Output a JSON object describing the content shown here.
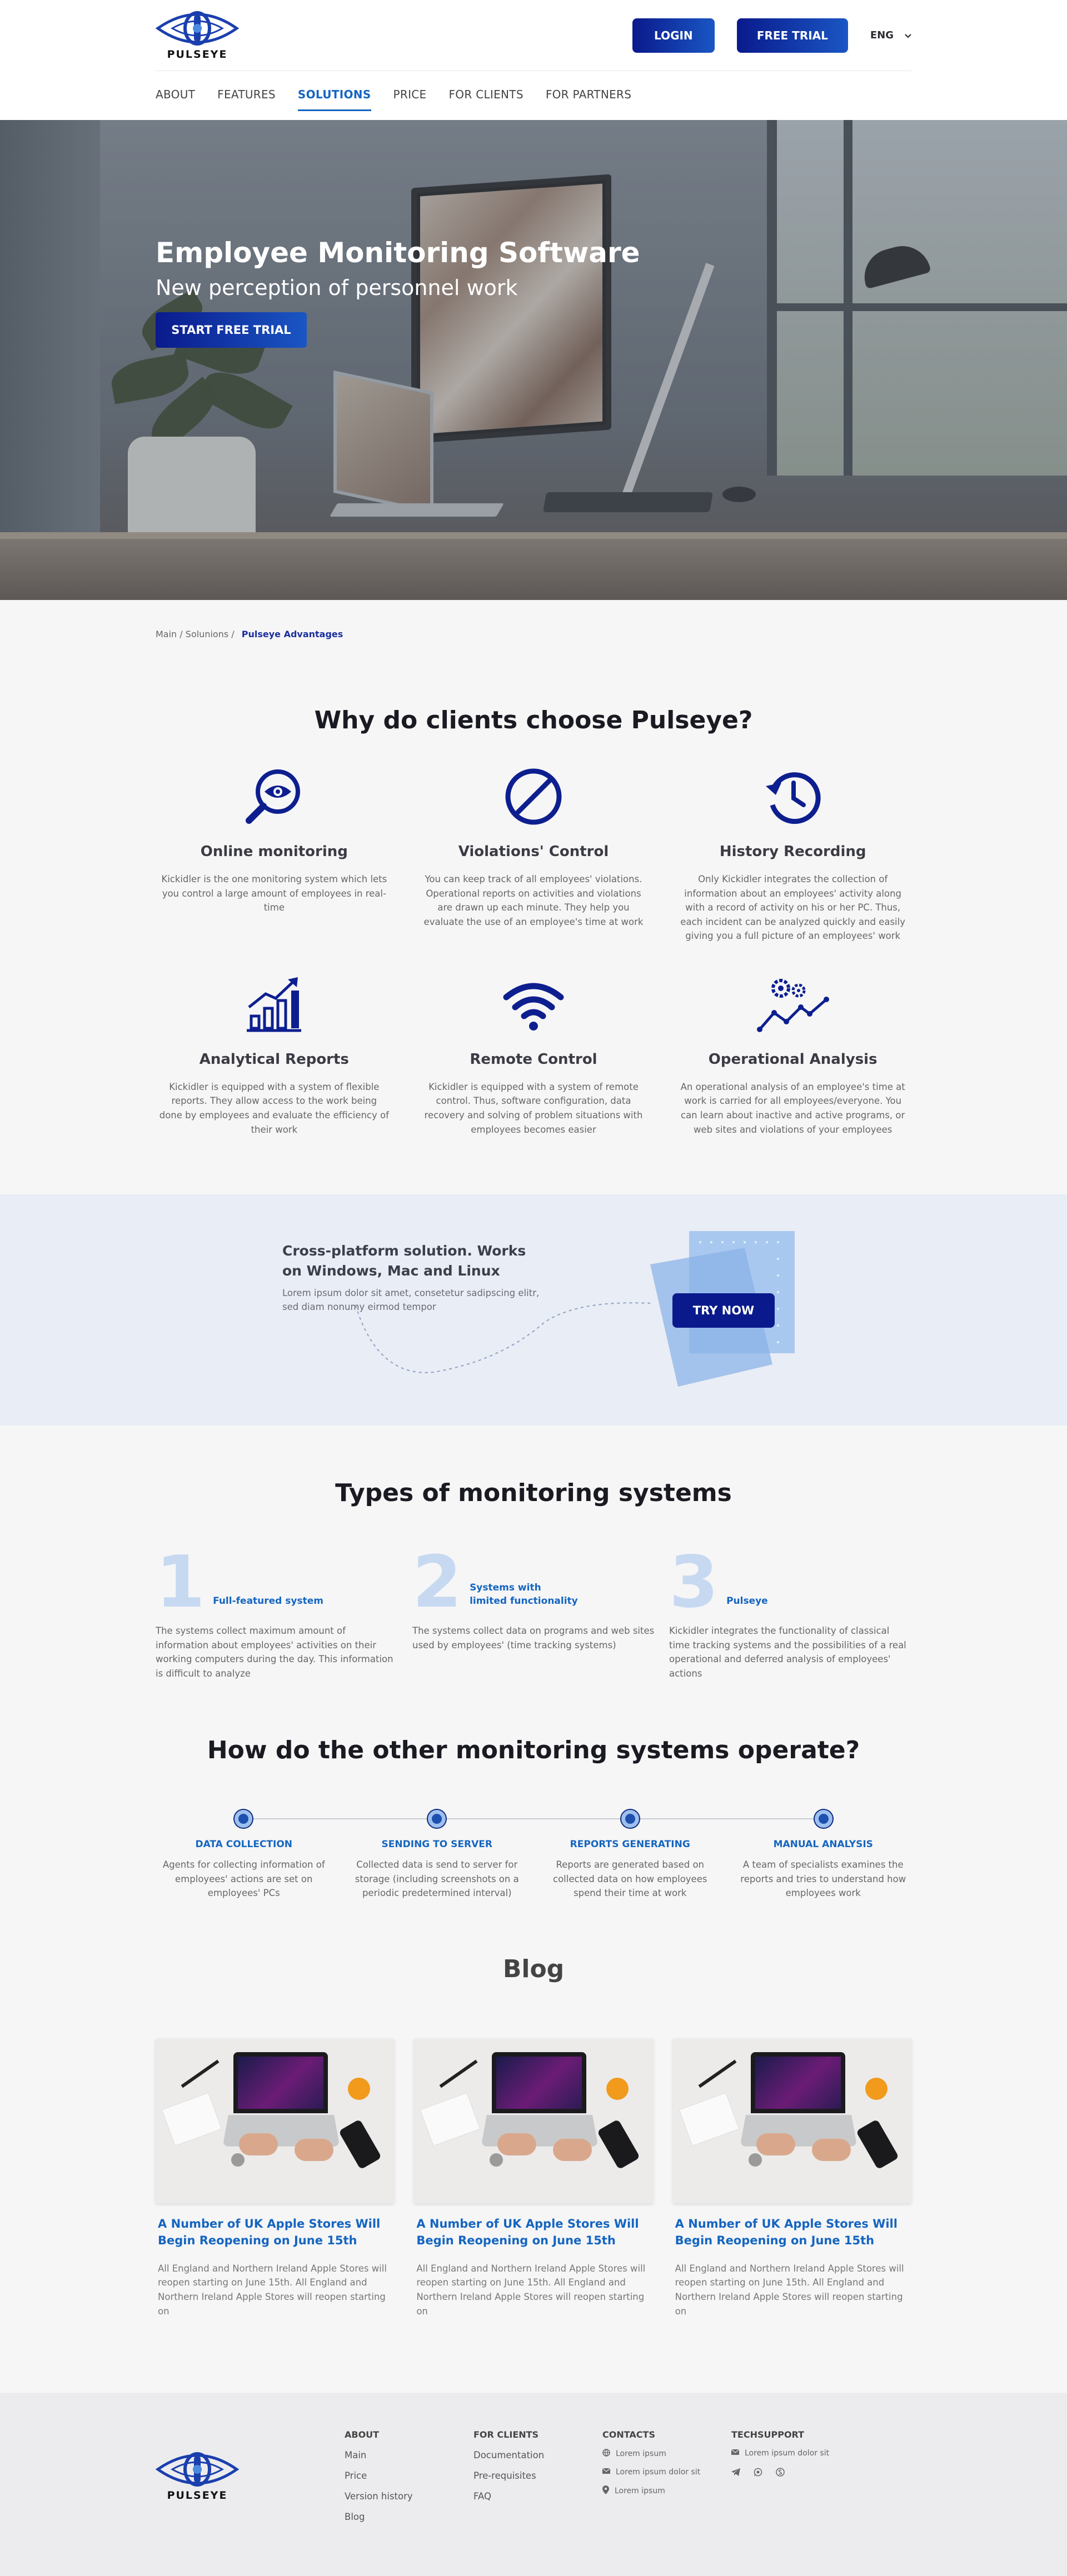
{
  "brand": {
    "name": "PULSEYE",
    "accent": "#1565c0",
    "dark": "#0a1a8c"
  },
  "header": {
    "login_label": "LOGIN",
    "trial_label": "FREE TRIAL",
    "lang": "ENG",
    "nav": [
      {
        "label": "ABOUT"
      },
      {
        "label": "FEATURES"
      },
      {
        "label": "SOLUTIONS",
        "active": true
      },
      {
        "label": "PRICE"
      },
      {
        "label": "FOR CLIENTS"
      },
      {
        "label": "FOR PARTNERS"
      }
    ]
  },
  "hero": {
    "title": "Employee Monitoring Software",
    "subtitle": "New perception of personnel work",
    "cta": "START FREE TRIAL"
  },
  "breadcrumbs": {
    "items": [
      "Main",
      "Solunions"
    ],
    "current": "Pulseye Advantages"
  },
  "why": {
    "title": "Why do clients choose Pulseye?",
    "features": [
      {
        "icon": "magnifier-eye-icon",
        "title": "Online monitoring",
        "desc": "Kickidler is the one monitoring system which lets you control a large amount of employees in real-time"
      },
      {
        "icon": "prohibited-icon",
        "title": "Violations' Control",
        "desc": "You can keep track of all employees' violations. Operational reports on activities and violations are drawn up each minute. They help you evaluate the use of an employee's time at work"
      },
      {
        "icon": "history-clock-icon",
        "title": "History Recording",
        "desc": "Only Kickidler integrates the collection of information about an employees' activity along with a record of activity on his or her PC. Thus, each incident can be analyzed quickly and easily giving you a full picture of an employees' work"
      },
      {
        "icon": "bar-chart-growth-icon",
        "title": "Analytical Reports",
        "desc": "Kickidler is equipped with a system of flexible reports. They allow access to the work being done by employees and evaluate the efficiency of their work"
      },
      {
        "icon": "wifi-icon",
        "title": "Remote Control",
        "desc": "Kickidler is equipped with a system of remote control. Thus, software configuration, data recovery and solving of problem situations with employees becomes easier"
      },
      {
        "icon": "gears-trend-icon",
        "title": "Operational Analysis",
        "desc": "An operational analysis of an employee's time at work is carried for all employees/everyone. You can learn about inactive and active programs, or web sites and violations of your employees"
      }
    ]
  },
  "cross": {
    "title": "Cross-platform solution. Works on Windows, Mac and Linux",
    "desc": "Lorem ipsum dolor sit amet, consetetur sadipscing elitr, sed diam nonumy eirmod tempor",
    "cta": "TRY NOW"
  },
  "types": {
    "title": "Types of monitoring systems",
    "items": [
      {
        "num": "1",
        "title": "Full-featured system",
        "desc": "The systems collect maximum amount of information about employees' activities on their working computers during the day. This information is difficult to analyze"
      },
      {
        "num": "2",
        "title": "Systems with limited functionality",
        "desc": "The systems collect data on programs and web sites used by employees' (time tracking systems)"
      },
      {
        "num": "3",
        "title": "Pulseye",
        "desc": "Kickidler integrates the functionality of classical time tracking systems and the possibilities of a real operational and deferred analysis of employees' actions"
      }
    ]
  },
  "process": {
    "title": "How do the other monitoring systems operate?",
    "steps": [
      {
        "title": "DATA COLLECTION",
        "desc": "Agents for collecting information of employees' actions are set on employees' PCs"
      },
      {
        "title": "SENDING TO SERVER",
        "desc": "Collected data is send to server for storage (including screenshots on a periodic predetermined interval)"
      },
      {
        "title": "REPORTS GENERATING",
        "desc": "Reports are generated based on collected data on how employees spend their time at work"
      },
      {
        "title": "MANUAL ANALYSIS",
        "desc": "A team of specialists examines the reports and tries to understand how employees work"
      }
    ]
  },
  "blog": {
    "title": "Blog",
    "posts": [
      {
        "title": "A Number of UK Apple Stores Will Begin Reopening on June 15th",
        "desc": "All England and Northern Ireland Apple Stores will reopen starting on June 15th. All England and Northern Ireland Apple Stores will reopen starting on"
      },
      {
        "title": "A Number of UK Apple Stores Will Begin Reopening on June 15th",
        "desc": "All England and Northern Ireland Apple Stores will reopen starting on June 15th. All England and Northern Ireland Apple Stores will reopen starting on"
      },
      {
        "title": "A Number of UK Apple Stores Will Begin Reopening on June 15th",
        "desc": "All England and Northern Ireland Apple Stores will reopen starting on June 15th. All England and Northern Ireland Apple Stores will reopen starting on"
      }
    ]
  },
  "footer": {
    "about": {
      "title": "ABOUT",
      "links": [
        "Main",
        "Price",
        "Version history",
        "Blog"
      ]
    },
    "clients": {
      "title": "FOR CLIENTS",
      "links": [
        "Documentation",
        "Pre-requisites",
        "FAQ"
      ]
    },
    "contacts": {
      "title": "CONTACTS",
      "items": [
        {
          "icon": "globe-icon",
          "text": "Lorem ipsum"
        },
        {
          "icon": "mail-icon",
          "text": "Lorem ipsum dolor sit"
        },
        {
          "icon": "location-pin-icon",
          "text": "Lorem ipsum"
        }
      ]
    },
    "tech": {
      "title": "TECHSUPPORT",
      "email": "Lorem ipsum dolor sit",
      "social": [
        "telegram-icon",
        "whatsapp-icon",
        "skype-icon"
      ]
    }
  }
}
